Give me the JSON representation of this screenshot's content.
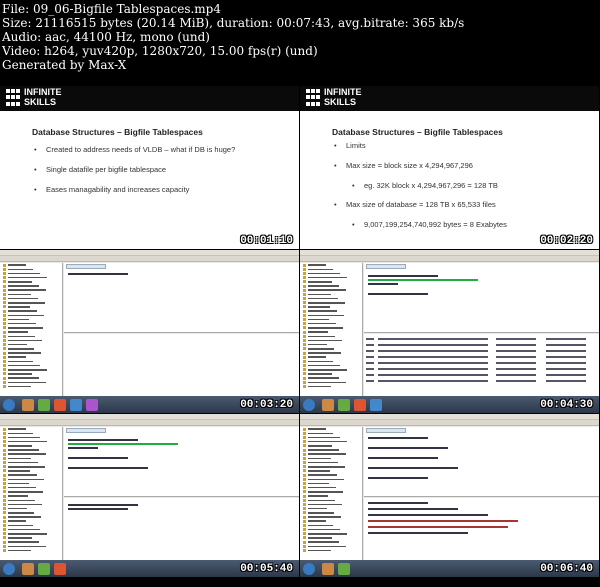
{
  "header": {
    "line1": "File: 09_06-Bigfile Tablespaces.mp4",
    "line2": "Size: 21116515 bytes (20.14 MiB), duration: 00:07:43, avg.bitrate: 365 kb/s",
    "line3": "Audio: aac, 44100 Hz, mono (und)",
    "line4": "Video: h264, yuv420p, 1280x720, 15.00 fps(r) (und)",
    "line5": "Generated by Max-X"
  },
  "logo": {
    "line1": "INFINITE",
    "line2": "SKILLS"
  },
  "slide1": {
    "title": "Database Structures – Bigfile Tablespaces",
    "bullets": [
      "Created to address needs of VLDB – what if DB is huge?",
      "Single datafile per bigfile tablespace",
      "Eases managability and increases capacity"
    ],
    "timestamp": "00:01:10"
  },
  "slide2": {
    "title": "Database Structures – Bigfile Tablespaces",
    "bullets": [
      "Limits",
      "Max size = block size x 4,294,967,296",
      "eg. 32K block x 4,294,967,296 = 128 TB",
      "Max size of database = 128 TB x 65,533 files",
      "9,007,199,254,740,992 bytes = 8 Exabytes"
    ],
    "timestamp": "00:02:20"
  },
  "thumbs": [
    {
      "timestamp": "00:03:20"
    },
    {
      "timestamp": "00:04:30"
    },
    {
      "timestamp": "00:05:40"
    },
    {
      "timestamp": "00:06:40"
    }
  ]
}
